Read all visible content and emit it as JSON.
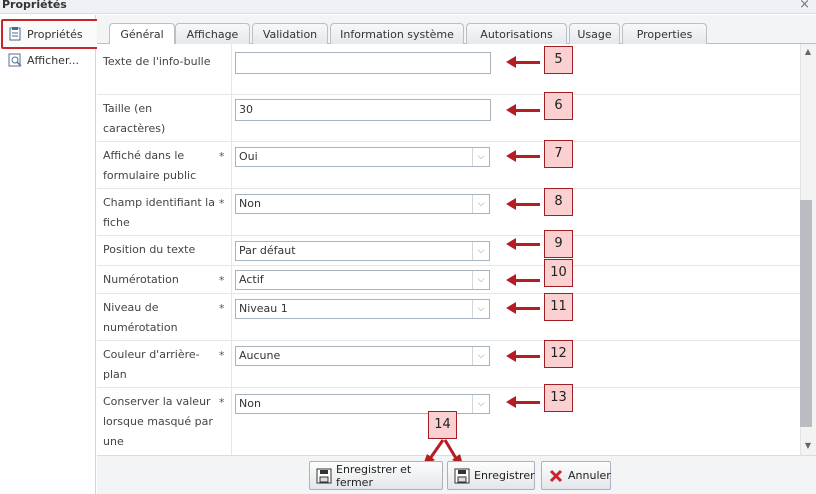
{
  "window": {
    "title": "Propriétés",
    "close_icon": "×"
  },
  "left_panel": {
    "items": [
      {
        "label": "Propriétés",
        "icon": "properties-icon"
      },
      {
        "label": "Afficher...",
        "icon": "preview-icon"
      }
    ]
  },
  "tabs": [
    {
      "label": "Général"
    },
    {
      "label": "Affichage"
    },
    {
      "label": "Validation"
    },
    {
      "label": "Information système"
    },
    {
      "label": "Autorisations"
    },
    {
      "label": "Usage"
    },
    {
      "label": "Properties"
    }
  ],
  "fields": [
    {
      "label": "Texte de l'info-bulle",
      "required": "",
      "type": "text",
      "value": "",
      "annotation": "5"
    },
    {
      "label": "Taille (en caractères)",
      "required": "",
      "type": "text",
      "value": "30",
      "annotation": "6"
    },
    {
      "label": "Affiché dans le formulaire public",
      "required": "*",
      "type": "select",
      "value": "Oui",
      "annotation": "7"
    },
    {
      "label": "Champ identifiant la fiche",
      "required": "*",
      "type": "select",
      "value": "Non",
      "annotation": "8"
    },
    {
      "label": "Position du texte",
      "required": "",
      "type": "select",
      "value": "Par défaut",
      "annotation": "9"
    },
    {
      "label": "Numérotation",
      "required": "*",
      "type": "select",
      "value": "Actif",
      "annotation": "10"
    },
    {
      "label": "Niveau de numérotation",
      "required": "*",
      "type": "select",
      "value": "Niveau 1",
      "annotation": "11"
    },
    {
      "label": "Couleur d'arrière-plan",
      "required": "*",
      "type": "select",
      "value": "Aucune",
      "annotation": "12"
    },
    {
      "label": "Conserver la valeur lorsque masqué par une",
      "required": "*",
      "type": "select",
      "value": "Non",
      "annotation": "13"
    }
  ],
  "footer": {
    "annotation": "14",
    "buttons": [
      {
        "label": "Enregistrer et fermer",
        "icon": "save-close-icon"
      },
      {
        "label": "Enregistrer",
        "icon": "save-icon"
      },
      {
        "label": "Annuler",
        "icon": "cancel-icon"
      }
    ]
  },
  "colors": {
    "annotation_fill": "#fbd0d0",
    "annotation_border": "#a11f24",
    "arrow": "#b31d23",
    "highlight_border": "#c8252b"
  }
}
